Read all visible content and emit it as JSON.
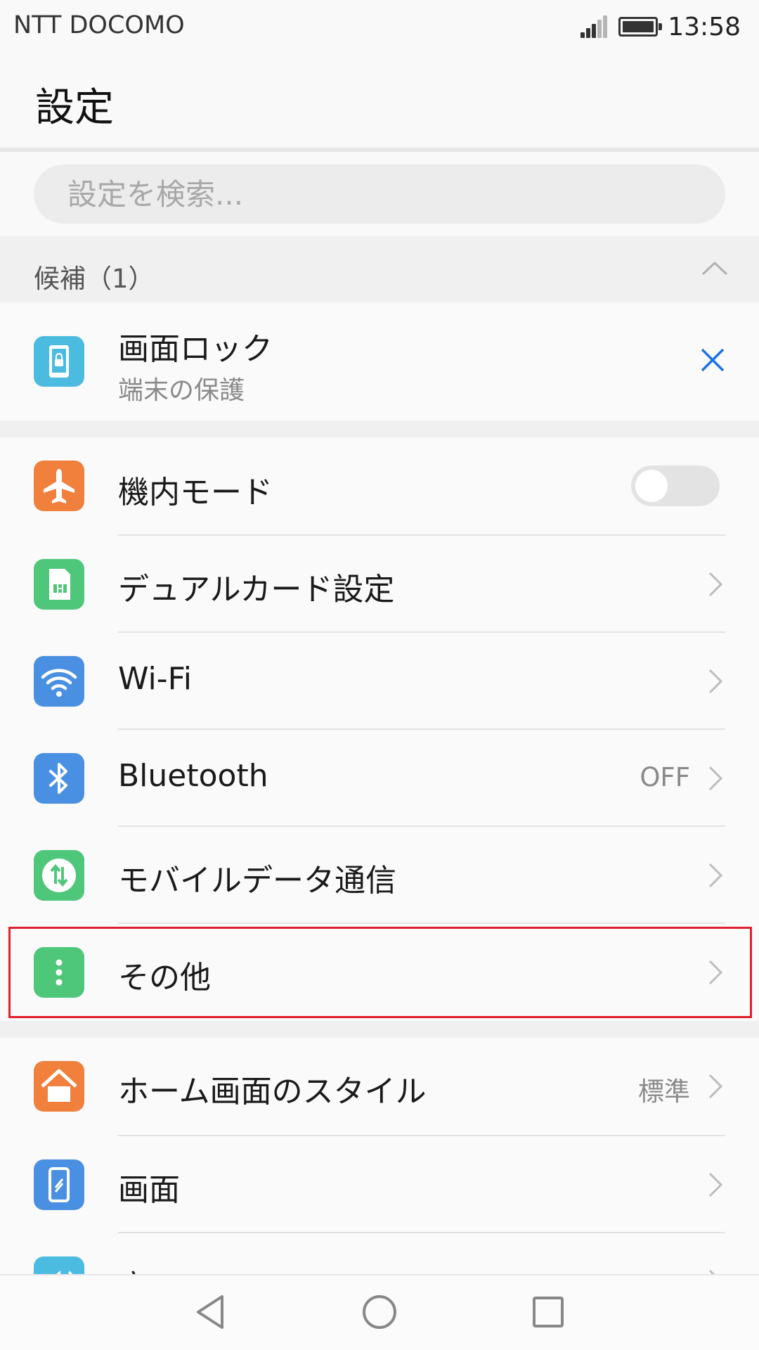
{
  "status_bar": {
    "carrier": "NTT DOCOMO",
    "time": "13:58"
  },
  "header": {
    "title": "設定"
  },
  "search": {
    "placeholder": "設定を検索..."
  },
  "suggestions": {
    "header": "候補（1）",
    "items": [
      {
        "title": "画面ロック",
        "subtitle": "端末の保護"
      }
    ]
  },
  "network_section": [
    {
      "label": "機内モード",
      "toggle": false
    },
    {
      "label": "デュアルカード設定"
    },
    {
      "label": "Wi-Fi"
    },
    {
      "label": "Bluetooth",
      "value": "OFF"
    },
    {
      "label": "モバイルデータ通信"
    },
    {
      "label": "その他",
      "highlighted": true
    }
  ],
  "display_section": [
    {
      "label": "ホーム画面のスタイル",
      "value": "標準"
    },
    {
      "label": "画面"
    },
    {
      "label": "音"
    }
  ],
  "colors": {
    "accent": "#1a73e8",
    "highlight_border": "#e0202a",
    "airplane_icon": "#f0803c",
    "sim_icon": "#4fc77a",
    "wifi_icon": "#4a90e2",
    "bluetooth_icon": "#4a90e2",
    "mobile_data_icon": "#4fc77a",
    "more_icon": "#4fc77a",
    "home_icon": "#f0803c",
    "display_icon": "#4a90e2",
    "lock_icon": "#4bbbe0",
    "sound_icon": "#4bbbe0"
  },
  "icons": [
    "lock-icon",
    "airplane-icon",
    "sim-card-icon",
    "wifi-icon",
    "bluetooth-icon",
    "mobile-data-icon",
    "more-icon",
    "home-icon",
    "display-icon",
    "sound-icon",
    "chevron-right-icon",
    "close-icon"
  ],
  "nav_bar": {
    "buttons": [
      "back-icon",
      "home-circle-icon",
      "recents-icon"
    ]
  }
}
